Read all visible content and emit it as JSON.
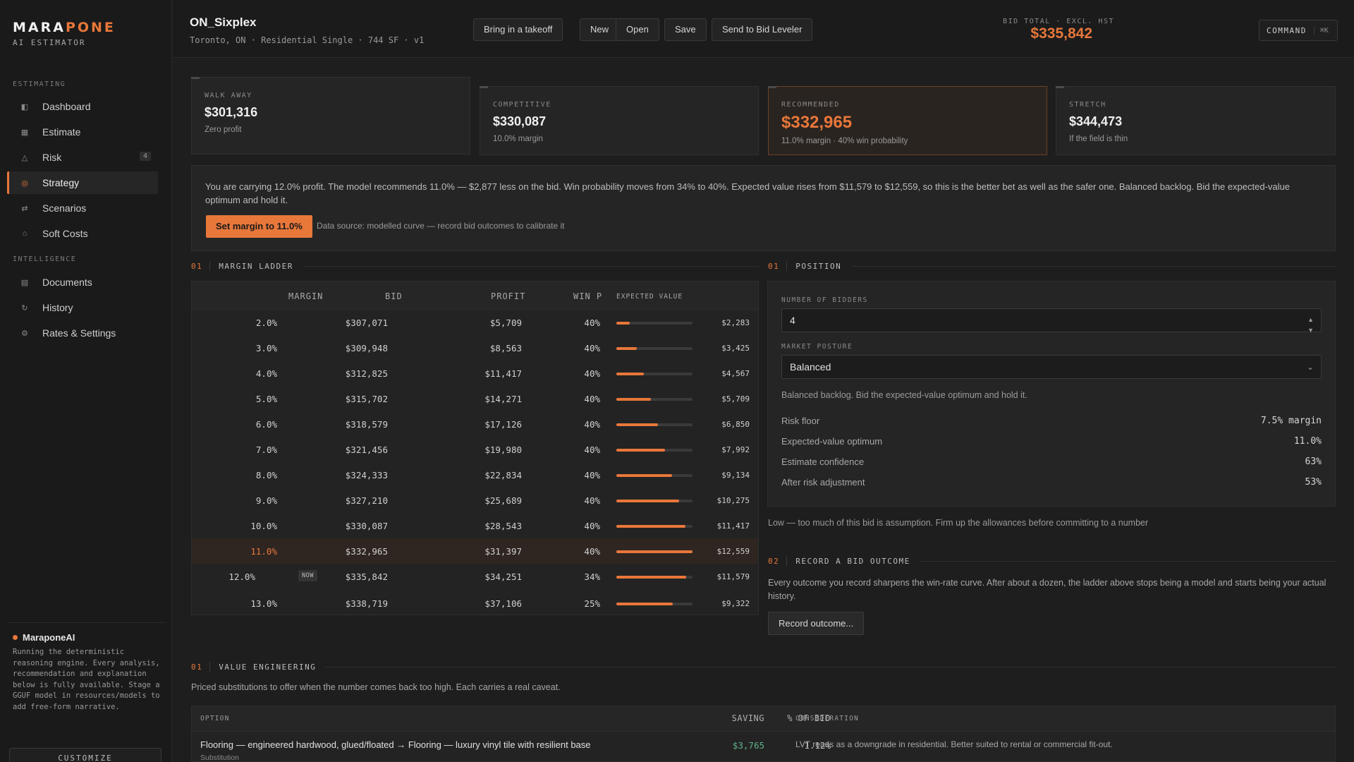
{
  "brand": {
    "name_part1": "MARA",
    "name_part2": "PONE",
    "subtitle": "AI ESTIMATOR"
  },
  "sidebar": {
    "section_estimating": "ESTIMATING",
    "section_intelligence": "INTELLIGENCE",
    "items": [
      {
        "label": "Dashboard",
        "icon": "dashboard-icon"
      },
      {
        "label": "Estimate",
        "icon": "estimate-icon"
      },
      {
        "label": "Risk",
        "icon": "warning-icon",
        "badge": "4"
      },
      {
        "label": "Strategy",
        "icon": "target-icon",
        "active": true
      },
      {
        "label": "Scenarios",
        "icon": "swap-icon"
      },
      {
        "label": "Soft Costs",
        "icon": "home-icon"
      },
      {
        "label": "Documents",
        "icon": "document-icon"
      },
      {
        "label": "History",
        "icon": "history-icon"
      },
      {
        "label": "Rates & Settings",
        "icon": "gear-icon"
      }
    ],
    "ai": {
      "title": "MaraponeAI",
      "text": "Running the deterministic reasoning engine. Every analysis, recommendation and explanation below is fully available. Stage a GGUF model in resources/models to add free-form narrative."
    },
    "customize_label": "CUSTOMIZE"
  },
  "header": {
    "title": "ON_Sixplex",
    "meta": "Toronto, ON · Residential Single · 744 SF · v1",
    "buttons": {
      "takeoff": "Bring in a takeoff",
      "new": "New",
      "open": "Open",
      "save": "Save",
      "send": "Send to Bid Leveler"
    },
    "bid_total_label": "BID TOTAL · EXCL. HST",
    "bid_total_value": "$335,842",
    "command_label": "COMMAND",
    "command_kbd": "⌘K"
  },
  "cards": [
    {
      "label": "WALK AWAY",
      "value": "$301,316",
      "sub": "Zero profit"
    },
    {
      "label": "COMPETITIVE",
      "value": "$330,087",
      "sub": "10.0% margin"
    },
    {
      "label": "RECOMMENDED",
      "value": "$332,965",
      "sub": "11.0% margin · 40% win probability"
    },
    {
      "label": "STRETCH",
      "value": "$344,473",
      "sub": "If the field is thin"
    }
  ],
  "advice": {
    "text": "You are carrying 12.0% profit. The model recommends 11.0% — $2,877 less on the bid. Win probability moves from 34% to 40%. Expected value rises from $11,579 to $12,559, so this is the better bet as well as the safer one. Balanced backlog. Bid the expected-value optimum and hold it.",
    "button": "Set margin to 11.0%",
    "source": "Data source: modelled curve — record bid outcomes to calibrate it"
  },
  "ladder": {
    "section_num": "01",
    "section_title": "MARGIN LADDER",
    "headers": {
      "margin": "MARGIN",
      "bid": "BID",
      "profit": "PROFIT",
      "winp": "WIN P",
      "ev": "EXPECTED VALUE"
    },
    "now_tag": "NOW",
    "rows": [
      {
        "margin": "2.0%",
        "bid": "$307,071",
        "profit": "$5,709",
        "winp": "40%",
        "ev": "$2,283",
        "ev_num": 2283
      },
      {
        "margin": "3.0%",
        "bid": "$309,948",
        "profit": "$8,563",
        "winp": "40%",
        "ev": "$3,425",
        "ev_num": 3425
      },
      {
        "margin": "4.0%",
        "bid": "$312,825",
        "profit": "$11,417",
        "winp": "40%",
        "ev": "$4,567",
        "ev_num": 4567
      },
      {
        "margin": "5.0%",
        "bid": "$315,702",
        "profit": "$14,271",
        "winp": "40%",
        "ev": "$5,709",
        "ev_num": 5709
      },
      {
        "margin": "6.0%",
        "bid": "$318,579",
        "profit": "$17,126",
        "winp": "40%",
        "ev": "$6,850",
        "ev_num": 6850
      },
      {
        "margin": "7.0%",
        "bid": "$321,456",
        "profit": "$19,980",
        "winp": "40%",
        "ev": "$7,992",
        "ev_num": 7992
      },
      {
        "margin": "8.0%",
        "bid": "$324,333",
        "profit": "$22,834",
        "winp": "40%",
        "ev": "$9,134",
        "ev_num": 9134
      },
      {
        "margin": "9.0%",
        "bid": "$327,210",
        "profit": "$25,689",
        "winp": "40%",
        "ev": "$10,275",
        "ev_num": 10275
      },
      {
        "margin": "10.0%",
        "bid": "$330,087",
        "profit": "$28,543",
        "winp": "40%",
        "ev": "$11,417",
        "ev_num": 11417
      },
      {
        "margin": "11.0%",
        "bid": "$332,965",
        "profit": "$31,397",
        "winp": "40%",
        "ev": "$12,559",
        "ev_num": 12559,
        "selected": true
      },
      {
        "margin": "12.0%",
        "bid": "$335,842",
        "profit": "$34,251",
        "winp": "34%",
        "ev": "$11,579",
        "ev_num": 11579,
        "now": true
      },
      {
        "margin": "13.0%",
        "bid": "$338,719",
        "profit": "$37,106",
        "winp": "25%",
        "ev": "$9,322",
        "ev_num": 9322
      }
    ]
  },
  "position": {
    "section_num": "01",
    "section_title": "POSITION",
    "bidders_label": "NUMBER OF BIDDERS",
    "bidders_value": "4",
    "posture_label": "MARKET POSTURE",
    "posture_value": "Balanced",
    "posture_note": "Balanced backlog. Bid the expected-value optimum and hold it.",
    "stats": [
      {
        "label": "Risk floor",
        "value": "7.5% margin"
      },
      {
        "label": "Expected-value optimum",
        "value": "11.0%"
      },
      {
        "label": "Estimate confidence",
        "value": "63%"
      },
      {
        "label": "After risk adjustment",
        "value": "53%"
      }
    ],
    "confidence_note": "Low — too much of this bid is assumption. Firm up the allowances before committing to a number"
  },
  "record": {
    "section_num": "02",
    "section_title": "RECORD A BID OUTCOME",
    "text": "Every outcome you record sharpens the win-rate curve. After about a dozen, the ladder above stops being a model and starts being your actual history.",
    "button": "Record outcome..."
  },
  "value_engineering": {
    "section_num": "01",
    "section_title": "VALUE ENGINEERING",
    "intro": "Priced substitutions to offer when the number comes back too high. Each carries a real caveat.",
    "headers": {
      "option": "OPTION",
      "saving": "SAVING",
      "pct": "% OF BID",
      "consideration": "CONSIDERATION"
    },
    "rows": [
      {
        "option": "Flooring — engineered hardwood, glued/floated → Flooring — luxury vinyl tile with resilient base",
        "kind": "Substitution",
        "saving": "$3,765",
        "pct": "1.12%",
        "consideration": "LVT reads as a downgrade in residential. Better suited to rental or commercial fit-out."
      }
    ]
  },
  "colors": {
    "accent": "#e8773a",
    "saving": "#5fb48a",
    "background": "#1e1e1e"
  }
}
